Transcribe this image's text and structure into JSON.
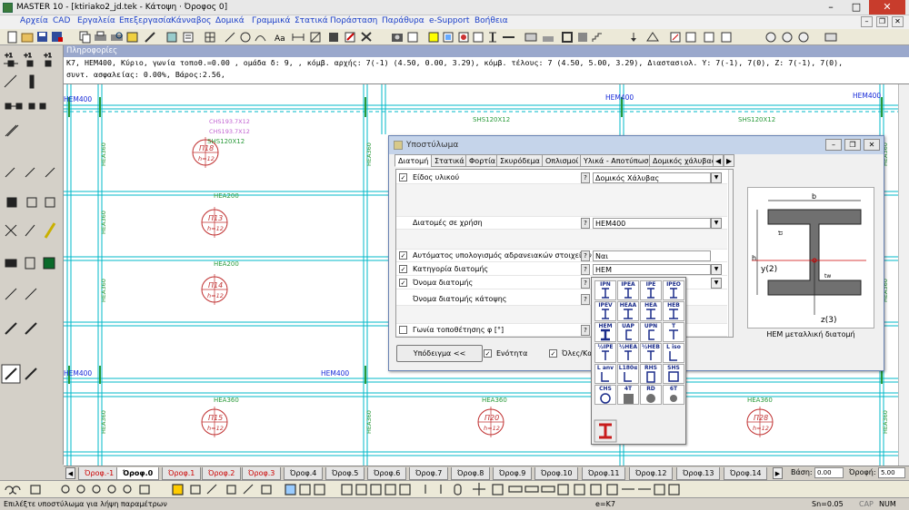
{
  "window": {
    "title": "MASTER 10 - [ktiriako2_jd.tek - Κάτοψη · Όροφος 0]"
  },
  "menu": [
    "Αρχεία",
    "CAD",
    "Εργαλεία",
    "Επεξεργασία",
    "Κάνναβος",
    "Δομικά",
    "Γραμμικά",
    "Στατικά",
    "Ποράσταση",
    "Παράθυρα",
    "e-Support",
    "Βοήθεια"
  ],
  "info": {
    "header": "Πληροφορίες",
    "line1": "K7, HEM400, Κύριο, γωνία τοποθ.=0.00 , ομάδα δ: 9, , κόμβ. αρχής: 7(-1) (4.50, 0.00, 3.29), κόμβ. τέλους: 7 (4.50, 5.00, 3.29), Διαστασιολ. Y: 7(-1), 7(0), Z: 7(-1), 7(0),",
    "line2": "συντ. ασφαλείας: 0.00%, Βάρος:2.56,"
  },
  "plan": {
    "beam_top": "HEM400",
    "beam_top_center": "HEM400",
    "beam_top_right": "HEM400",
    "beam_mid": "HEM400",
    "shs_left": "SHS120X12",
    "shs_right": "SHS120X12",
    "shs_small": "SHS120X12",
    "chs1": "CHS193.7X12",
    "chs2": "CHS193.7X12",
    "col_side": "HEA360",
    "hea200": "HEA200",
    "hea360": "HEA360",
    "h12": "h=12",
    "panels": [
      "Π18",
      "Π13",
      "Π14",
      "Π15",
      "Π20",
      "Π28"
    ]
  },
  "floors": {
    "tabs": [
      "Όροφ.-1",
      "Όροφ.0",
      "Όροφ.1",
      "Όροφ.2",
      "Όροφ.3",
      "Όροφ.4",
      "Όροφ.5",
      "Όροφ.6",
      "Όροφ.7",
      "Όροφ.8",
      "Όροφ.9",
      "Όροφ.10",
      "Όροφ.11",
      "Όροφ.12",
      "Όροφ.13",
      "Όροφ.14"
    ],
    "base_label": "Βάση:",
    "base_value": "0.00",
    "floor_label": "Όροφή:",
    "floor_value": "5.00"
  },
  "status": {
    "hint": "Επιλέξτε υποστύλωμα για λήψη παραμέτρων",
    "element": "e=K7",
    "snap": "Sn=0.05",
    "caps": "CAP",
    "num": "NUM"
  },
  "dialog": {
    "title": "Υποστύλωμα",
    "tabs": [
      "Διατομή",
      "Στατικά",
      "Φορτία",
      "Σκυρόδεμα",
      "Οπλισμοί",
      "Υλικά - Αποτύπωση",
      "Δομικός χάλυβας"
    ],
    "rows": [
      {
        "label": "Είδος υλικού",
        "value": "Δομικός Χάλυβας",
        "checked": "✓"
      },
      {
        "label": "Διατομές σε χρήση",
        "value": "HEM400",
        "checked": ""
      },
      {
        "label": "Αυτόματος υπολογισμός αδρανειακών στοιχείων",
        "value": "Ναι",
        "checked": "✓"
      },
      {
        "label": "Κατηγορία διατομής",
        "value": "HEM",
        "checked": "✓"
      },
      {
        "label": "Όνομα διατομής",
        "value": "",
        "checked": "✓"
      },
      {
        "label": "Όνομα διατομής κάτοψης",
        "value": "",
        "checked": ""
      },
      {
        "label": "Γωνία τοποθέτησης φ [°]",
        "value": "",
        "checked": ""
      }
    ],
    "sample_button": "Υπόδειγμα <<",
    "unity_label": "Ενότητα",
    "all_label": "Όλες/Κα",
    "profile_caption": "HEM μεταλλική διατομή",
    "profile_b": "b",
    "profile_h": "h",
    "profile_tf": "tf",
    "profile_tw": "tw",
    "profile_y": "y(2)",
    "profile_z": "z(3)"
  },
  "palette": [
    "IPN",
    "IPEA",
    "IPE",
    "IPEO",
    "IPEV",
    "HEAA",
    "HEA",
    "HEB",
    "HEM",
    "UAP",
    "UPN",
    "T",
    "½IPE",
    "½HEA",
    "½HEB",
    "L iso",
    "L anv",
    "L180α",
    "RHS",
    "SHS",
    "CHS",
    "4T",
    "RD",
    "6T"
  ],
  "colors": {
    "accent": "#1a3ec8",
    "beam": "#1428d8",
    "column": "#2a9a3a",
    "grid": "#00b8c8",
    "selected": "#d81c1c"
  }
}
